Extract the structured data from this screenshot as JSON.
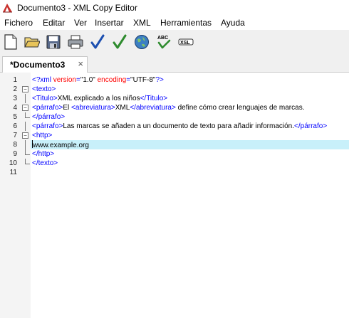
{
  "window": {
    "title": "Documento3 - XML Copy Editor"
  },
  "menubar": {
    "items": [
      "Fichero",
      "Editar",
      "Ver",
      "Insertar",
      "XML",
      "Herramientas",
      "Ayuda"
    ]
  },
  "toolbar": {
    "icons": [
      "new-file-icon",
      "open-folder-icon",
      "save-icon",
      "print-icon",
      "check-wellformed-icon",
      "validate-icon",
      "browser-globe-icon",
      "spellcheck-icon",
      "xslt-icon"
    ],
    "spell_label": "ABC",
    "xslt_label": "XSL"
  },
  "tabs": [
    {
      "label": "*Documento3",
      "close": "×"
    }
  ],
  "editor": {
    "current_line": 8,
    "line_numbers": [
      "1",
      "2",
      "3",
      "4",
      "5",
      "6",
      "7",
      "8",
      "9",
      "10",
      "11"
    ],
    "lines": [
      [
        [
          "b",
          "<?xml"
        ],
        [
          "a",
          " version"
        ],
        [
          "b",
          "="
        ],
        [
          "s",
          "\"1.0\""
        ],
        [
          "a",
          " encoding"
        ],
        [
          "b",
          "="
        ],
        [
          "s",
          "\"UTF-8\""
        ],
        [
          "b",
          "?>"
        ]
      ],
      [
        [
          "b",
          "<texto>"
        ]
      ],
      [
        [
          "b",
          "<Titulo>"
        ],
        [
          "t",
          "XML explicado a los niños"
        ],
        [
          "b",
          "</Titulo>"
        ]
      ],
      [
        [
          "b",
          "<párrafo>"
        ],
        [
          "t",
          "El "
        ],
        [
          "b",
          "<abreviatura>"
        ],
        [
          "t",
          "XML"
        ],
        [
          "b",
          "</abreviatura>"
        ],
        [
          "t",
          " define cómo crear lenguajes de marcas."
        ]
      ],
      [
        [
          "b",
          "</párrafo>"
        ]
      ],
      [
        [
          "b",
          "<párrafo>"
        ],
        [
          "t",
          "Las marcas se añaden a un documento de texto para añadir información."
        ],
        [
          "b",
          "</párrafo>"
        ]
      ],
      [
        [
          "b",
          "<http>"
        ]
      ],
      [
        [
          "t",
          "www.example.org"
        ]
      ],
      [
        [
          "b",
          "</http>"
        ]
      ],
      [
        [
          "b",
          "</texto>"
        ]
      ],
      []
    ]
  }
}
